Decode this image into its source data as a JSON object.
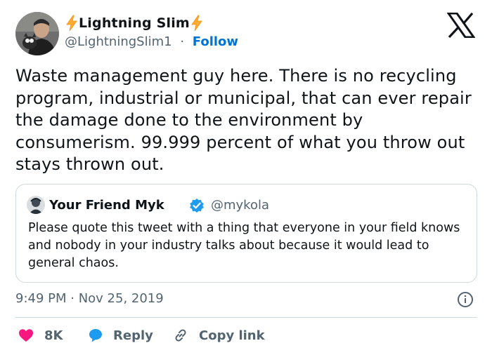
{
  "author": {
    "display_name": "Lightning Slim",
    "handle": "@LightningSlim1",
    "separator": "·",
    "follow_label": "Follow"
  },
  "tweet": {
    "text": "Waste management guy here. There is no recycling program, industrial or municipal, that can ever repair the damage done to the environment by consumerism. 99.999 percent of what you throw out stays thrown out."
  },
  "quoted_tweet": {
    "display_name": "Your Friend Myk",
    "handle": "@mykola",
    "text": "Please quote this tweet with a thing that everyone in your field knows and nobody in your industry talks about because it would lead to general chaos."
  },
  "meta": {
    "timestamp": "9:49 PM · Nov 25, 2019"
  },
  "actions": {
    "like_count": "8K",
    "reply_label": "Reply",
    "copy_link_label": "Copy link"
  },
  "icons": {
    "name_emoji": "lightning-bolt-icon",
    "brand": "x-logo-icon",
    "verified": "verified-badge-icon",
    "info": "info-icon",
    "like": "heart-icon",
    "reply": "reply-bubble-icon",
    "copy": "link-icon"
  },
  "colors": {
    "text": "#0f1419",
    "secondary": "#536471",
    "link": "#0074d4",
    "like": "#f91880",
    "reply": "#1d9bf0",
    "verified": "#1d9bf0",
    "bolt": "#ffac33",
    "border": "#cfd9de"
  }
}
